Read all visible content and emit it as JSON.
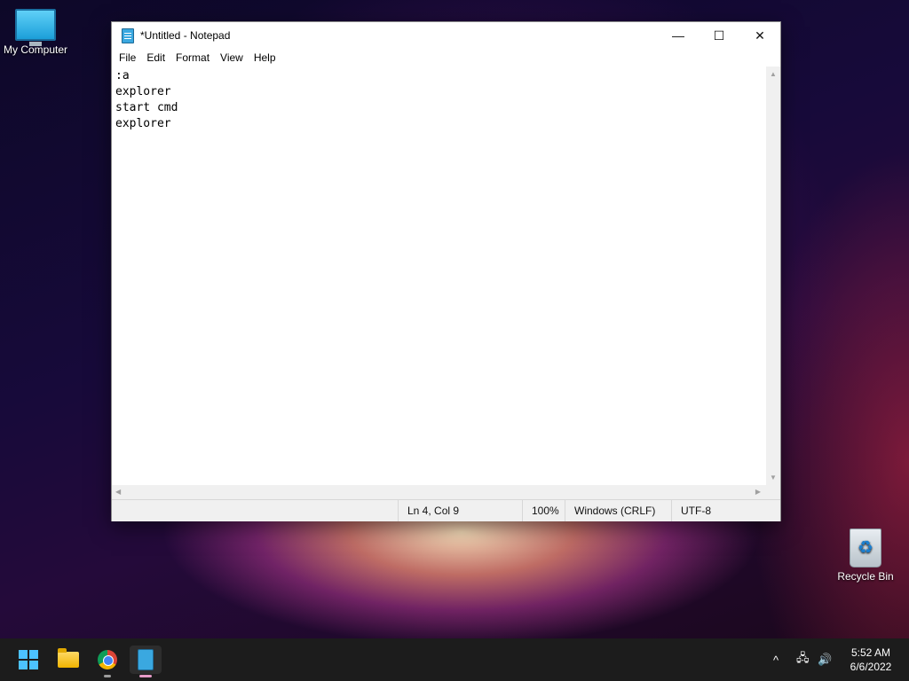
{
  "desktop": {
    "icons": [
      {
        "label": "My Computer",
        "icon": "monitor-icon"
      },
      {
        "label": "Recycle Bin",
        "icon": "recycle-bin-icon"
      }
    ]
  },
  "window": {
    "title": "*Untitled - Notepad",
    "controls": {
      "minimize": "—",
      "maximize": "☐",
      "close": "✕"
    },
    "menu": [
      "File",
      "Edit",
      "Format",
      "View",
      "Help"
    ],
    "content": ":a\nexplorer\nstart cmd\nexplorer",
    "status": {
      "position": "Ln 4, Col 9",
      "zoom": "100%",
      "line_ending": "Windows (CRLF)",
      "encoding": "UTF-8"
    }
  },
  "taskbar": {
    "apps": [
      {
        "name": "start",
        "icon": "windows-start-icon"
      },
      {
        "name": "file-explorer",
        "icon": "folder-icon"
      },
      {
        "name": "chrome",
        "icon": "chrome-icon"
      },
      {
        "name": "notepad",
        "icon": "notepad-icon",
        "active": true
      }
    ],
    "tray": {
      "chevron": "^",
      "network": "🖧",
      "volume": "🔊"
    },
    "clock": {
      "time": "5:52 AM",
      "date": "6/6/2022"
    }
  },
  "colors": {
    "accent": "#4cc2ff",
    "taskbar": "#1c1c1c",
    "chrome_bg": "#f0f0f0"
  }
}
